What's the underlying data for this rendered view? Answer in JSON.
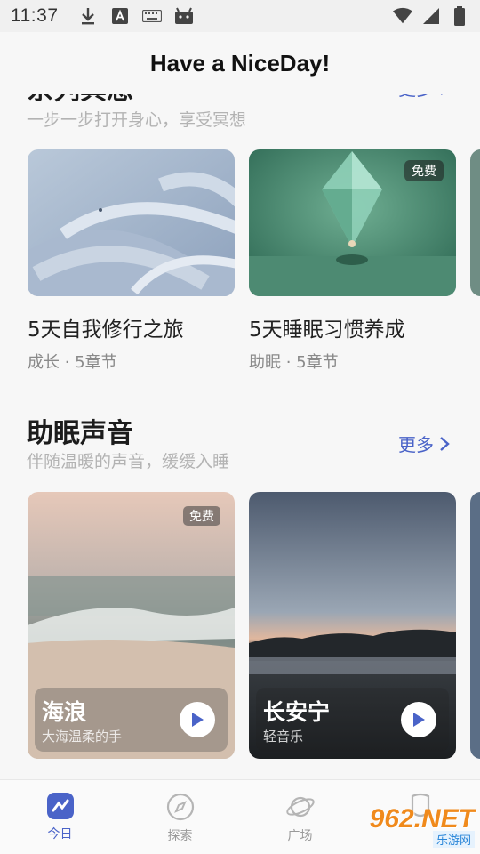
{
  "status_bar": {
    "time": "11:37"
  },
  "header": {
    "title": "Have a NiceDay!"
  },
  "series_section": {
    "title": "系列冥想",
    "subtitle": "一步一步打开身心，享受冥想",
    "more_label": "更多",
    "cards": [
      {
        "title": "5天自我修行之旅",
        "meta": "成长 · 5章节",
        "badge": ""
      },
      {
        "title": "5天睡眠习惯养成",
        "meta": "助眠 · 5章节",
        "badge": "免费"
      }
    ]
  },
  "sleep_section": {
    "title": "助眠声音",
    "subtitle": "伴随温暖的声音，缓缓入睡",
    "more_label": "更多",
    "cards": [
      {
        "name": "海浪",
        "desc": "大海温柔的手",
        "badge": "免费"
      },
      {
        "name": "长安宁",
        "desc": "轻音乐",
        "badge": ""
      }
    ]
  },
  "bottom_nav": {
    "items": [
      {
        "label": "今日",
        "icon": "today-icon",
        "active": true
      },
      {
        "label": "探索",
        "icon": "compass-icon",
        "active": false
      },
      {
        "label": "广场",
        "icon": "planet-icon",
        "active": false
      }
    ]
  },
  "watermark": {
    "main": "962.NET",
    "sub": "乐游网"
  },
  "colors": {
    "accent": "#4a63c8",
    "background": "#f7f7f7"
  }
}
